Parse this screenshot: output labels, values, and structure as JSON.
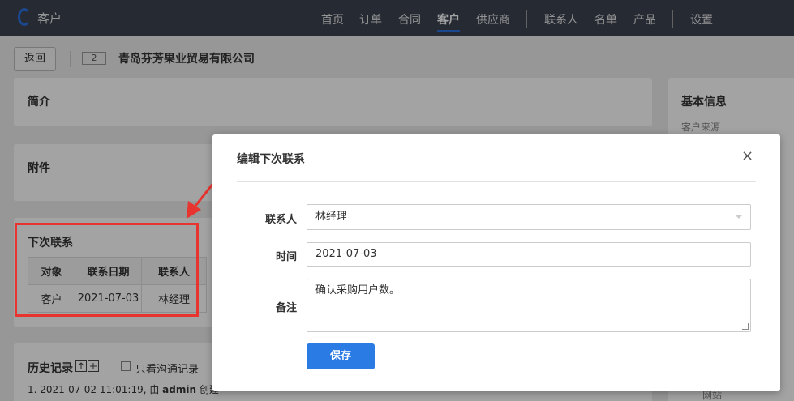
{
  "app": {
    "title": "客户"
  },
  "nav": {
    "items": [
      "首页",
      "订单",
      "合同",
      "客户",
      "供应商",
      "联系人",
      "名单",
      "产品",
      "设置"
    ],
    "active": "客户"
  },
  "header": {
    "back_label": "返回",
    "id_badge": "2",
    "company_name": "青岛芬芳果业贸易有限公司"
  },
  "panels": {
    "intro_title": "简介",
    "attachments_title": "附件",
    "next_contact_title": "下次联系",
    "basic_info_title": "基本信息",
    "customer_source_label": "客户来源",
    "website_label": "网站"
  },
  "next_contact_table": {
    "headers": [
      "对象",
      "联系日期",
      "联系人"
    ],
    "rows": [
      [
        "客户",
        "2021-07-03",
        "林经理"
      ]
    ]
  },
  "history": {
    "title": "历史记录",
    "filter_label": "只看沟通记录",
    "entry_prefix": "1. 2021-07-02 11:01:19, 由 ",
    "entry_user": "admin",
    "entry_suffix": " 创建"
  },
  "modal": {
    "title": "编辑下次联系",
    "close": "×",
    "contact_label": "联系人",
    "contact_value": "林经理",
    "time_label": "时间",
    "time_value": "2021-07-03",
    "note_label": "备注",
    "note_value": "确认采购用户数。",
    "save_label": "保存"
  },
  "colors": {
    "accent": "#2b7be4",
    "nav_bg": "#3c4350",
    "annotation": "#e8342f"
  }
}
